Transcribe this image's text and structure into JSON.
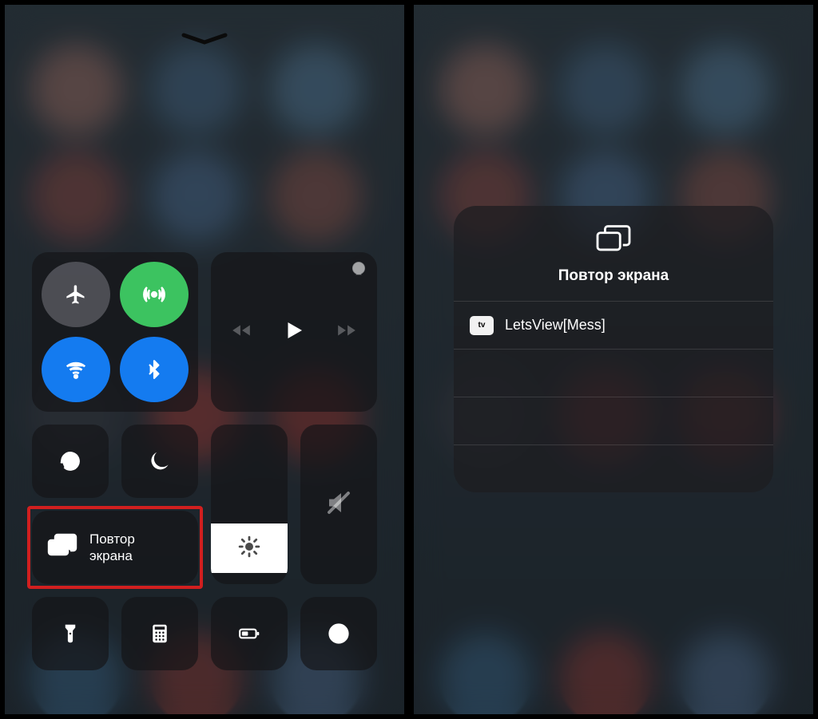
{
  "left": {
    "screen_mirror_label": "Повтор\nэкрана"
  },
  "right": {
    "sheet_title": "Повтор экрана",
    "device_icon_text": "tv",
    "device_label": "LetsView[Mess]"
  }
}
